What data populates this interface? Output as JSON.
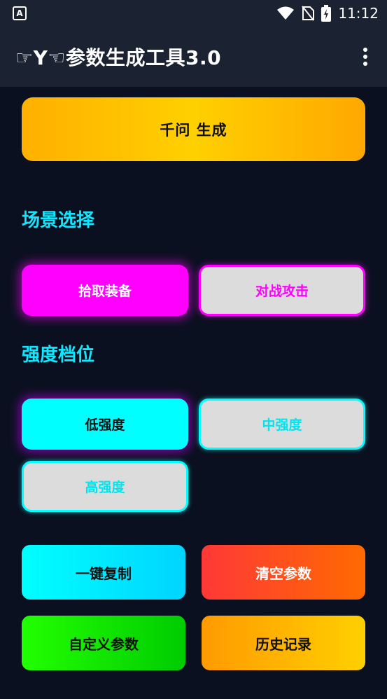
{
  "status": {
    "time": "11:12",
    "left_icon": "A"
  },
  "app": {
    "title": "☞Y☜参数生成工具3.0"
  },
  "generate": {
    "label": "千问  生成"
  },
  "scene": {
    "title": "场景选择",
    "options": [
      {
        "label": "拾取装备",
        "selected": true
      },
      {
        "label": "对战攻击",
        "selected": false
      }
    ]
  },
  "strength": {
    "title": "强度档位",
    "options": [
      {
        "label": "低强度",
        "selected": true
      },
      {
        "label": "中强度",
        "selected": false
      },
      {
        "label": "高强度",
        "selected": false
      }
    ]
  },
  "actions": {
    "copy": "一键复制",
    "clear": "清空参数",
    "custom": "自定义参数",
    "history": "历史记录"
  },
  "colors": {
    "magenta": "#ff00ff",
    "cyan": "#00ffff",
    "title_cyan": "#11e6ff",
    "gold": "#ffc800",
    "red": "#ff4030",
    "green": "#22ee00"
  }
}
